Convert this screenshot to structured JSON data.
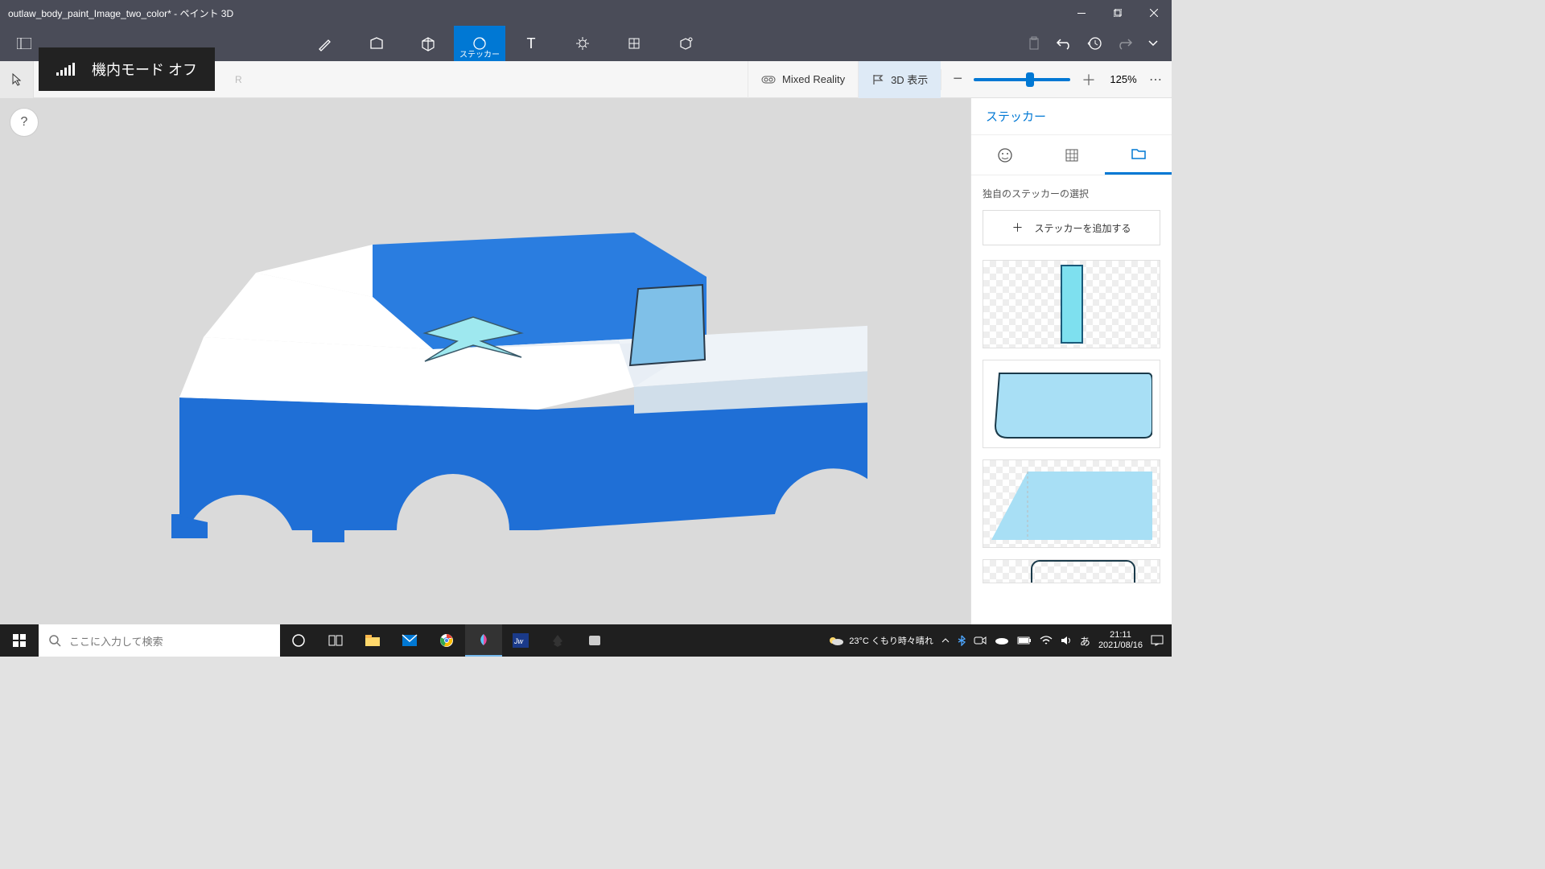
{
  "titlebar": {
    "title": "outlaw_body_paint_Image_two_color* - ペイント 3D"
  },
  "menubar": {
    "sticker_label": "ステッカー"
  },
  "notification": {
    "text": "機内モード オフ"
  },
  "toolbar": {
    "hidden_r": "R",
    "mixed_reality": "Mixed Reality",
    "view_3d": "3D 表示",
    "zoom": "125%"
  },
  "help": {
    "label": "?"
  },
  "sidepanel": {
    "title": "ステッカー",
    "section_label": "独自のステッカーの選択",
    "add_label": "ステッカーを追加する",
    "add_plus": "＋"
  },
  "taskbar": {
    "search_placeholder": "ここに入力して検索",
    "weather": "23°C くもり時々晴れ",
    "ime": "あ",
    "time": "21:11",
    "date": "2021/08/16"
  }
}
